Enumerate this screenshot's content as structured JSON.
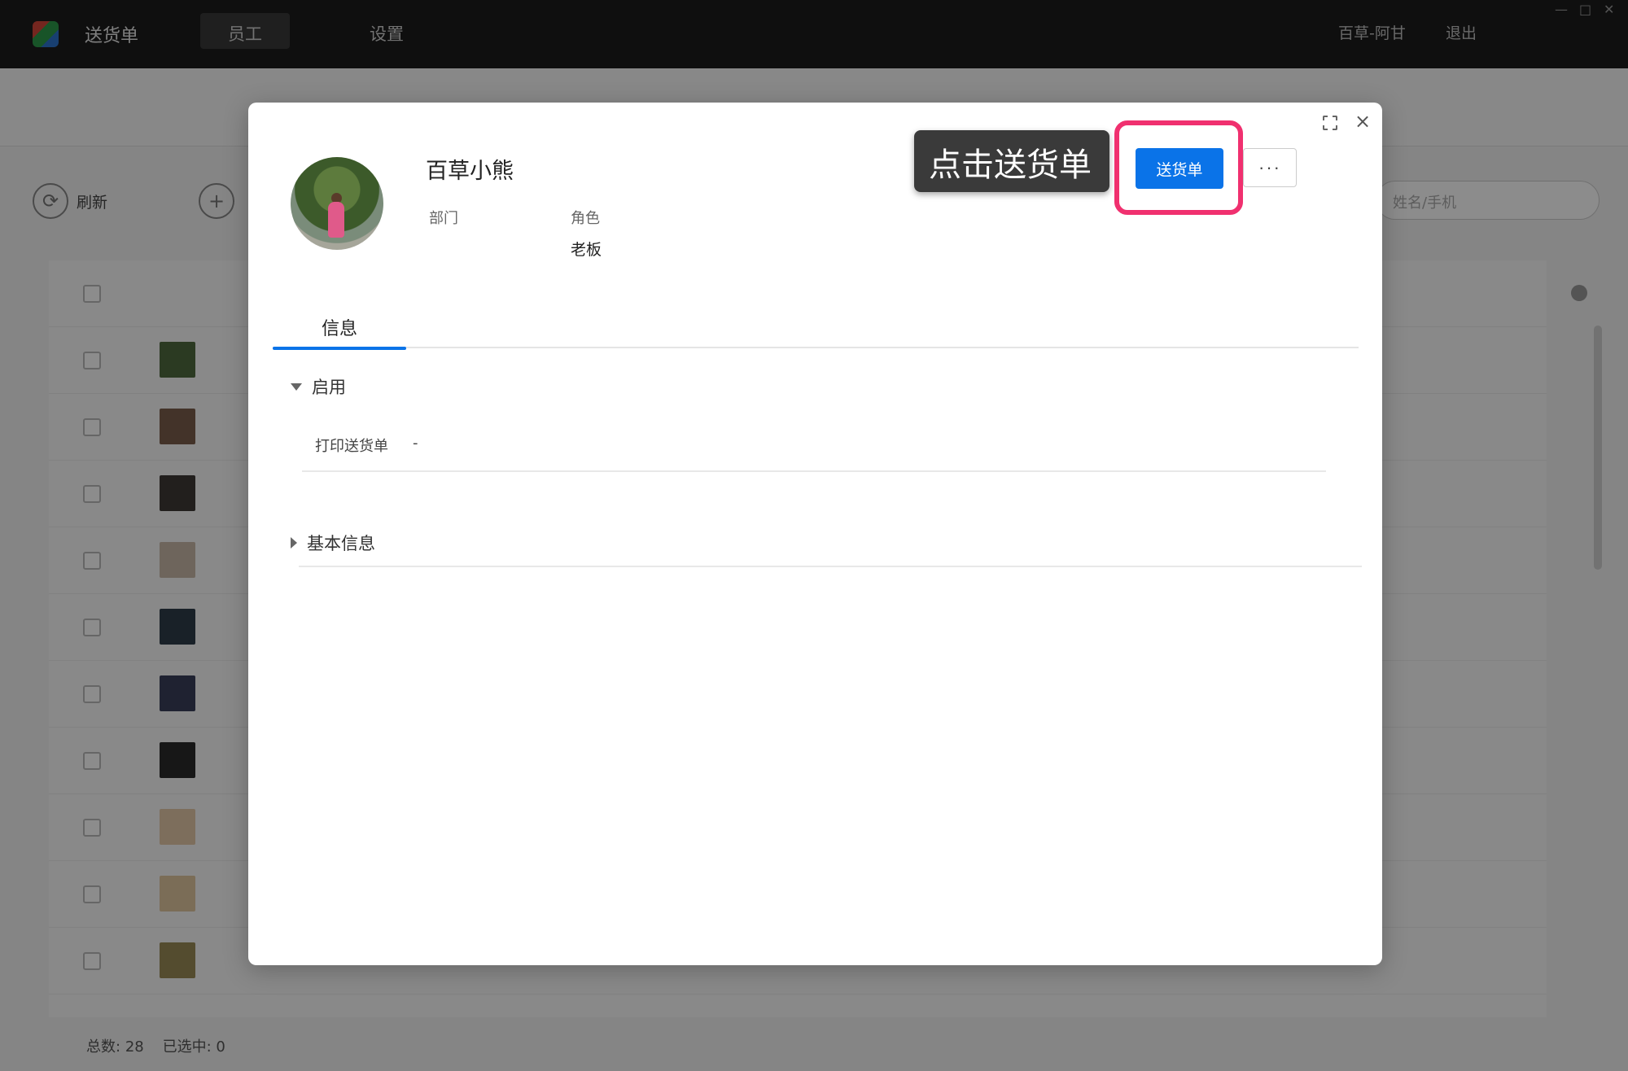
{
  "app": {
    "title": "送货单"
  },
  "nav": {
    "tabs": [
      {
        "label": "员工"
      },
      {
        "label": "设置"
      }
    ]
  },
  "topbar_right": {
    "user": "百草-阿甘",
    "logout": "退出"
  },
  "toolbar": {
    "refresh_label": "刷新",
    "search_placeholder": "姓名/手机"
  },
  "footer": {
    "total_label": "总数:",
    "total_value": "28",
    "selected_label": "已选中:",
    "selected_value": "0"
  },
  "modal": {
    "user_name": "百草小熊",
    "department_label": "部门",
    "department_value": "",
    "role_label": "角色",
    "role_value": "老板",
    "tooltip_text": "点击送货单",
    "primary_button": "送货单",
    "more_button": "···",
    "tabs": [
      {
        "label": "信息"
      }
    ],
    "sections": [
      {
        "title": "启用",
        "expanded": true,
        "fields": [
          {
            "label": "打印送货单",
            "value": "-"
          }
        ]
      },
      {
        "title": "基本信息",
        "expanded": false
      }
    ]
  },
  "colors": {
    "primary": "#0a73e8",
    "highlight": "#f0306f",
    "tooltip_bg": "#3a3a3a"
  }
}
